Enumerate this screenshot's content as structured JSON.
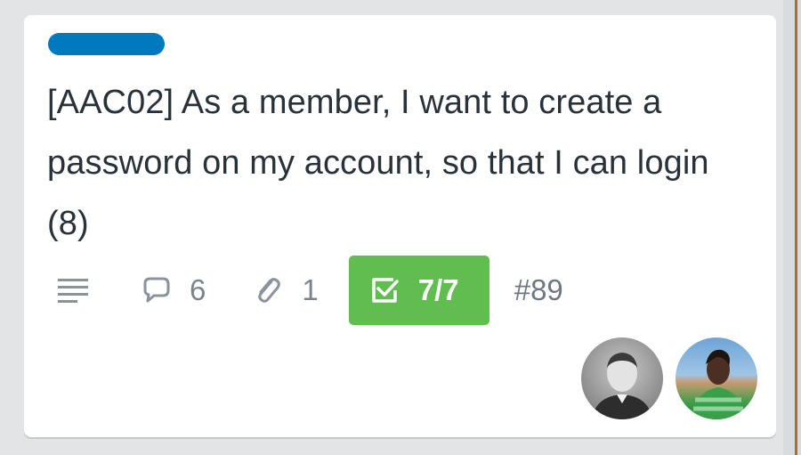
{
  "card": {
    "title": "[AAC02] As a member, I want to create a password on my account, so that I can login (8)",
    "label_color": "#0079bf",
    "badges": {
      "description_icon": "description-lines-icon",
      "comment_icon": "speech-bubble-icon",
      "comments": "6",
      "attachment_icon": "paperclip-icon",
      "attachments": "1",
      "checklist_icon": "checkbox-checked-icon",
      "checklist": "7/7",
      "checklist_color": "#61bd4f",
      "card_number": "#89"
    },
    "members": [
      {
        "avatar": "member-avatar"
      },
      {
        "avatar": "member-avatar"
      }
    ]
  }
}
